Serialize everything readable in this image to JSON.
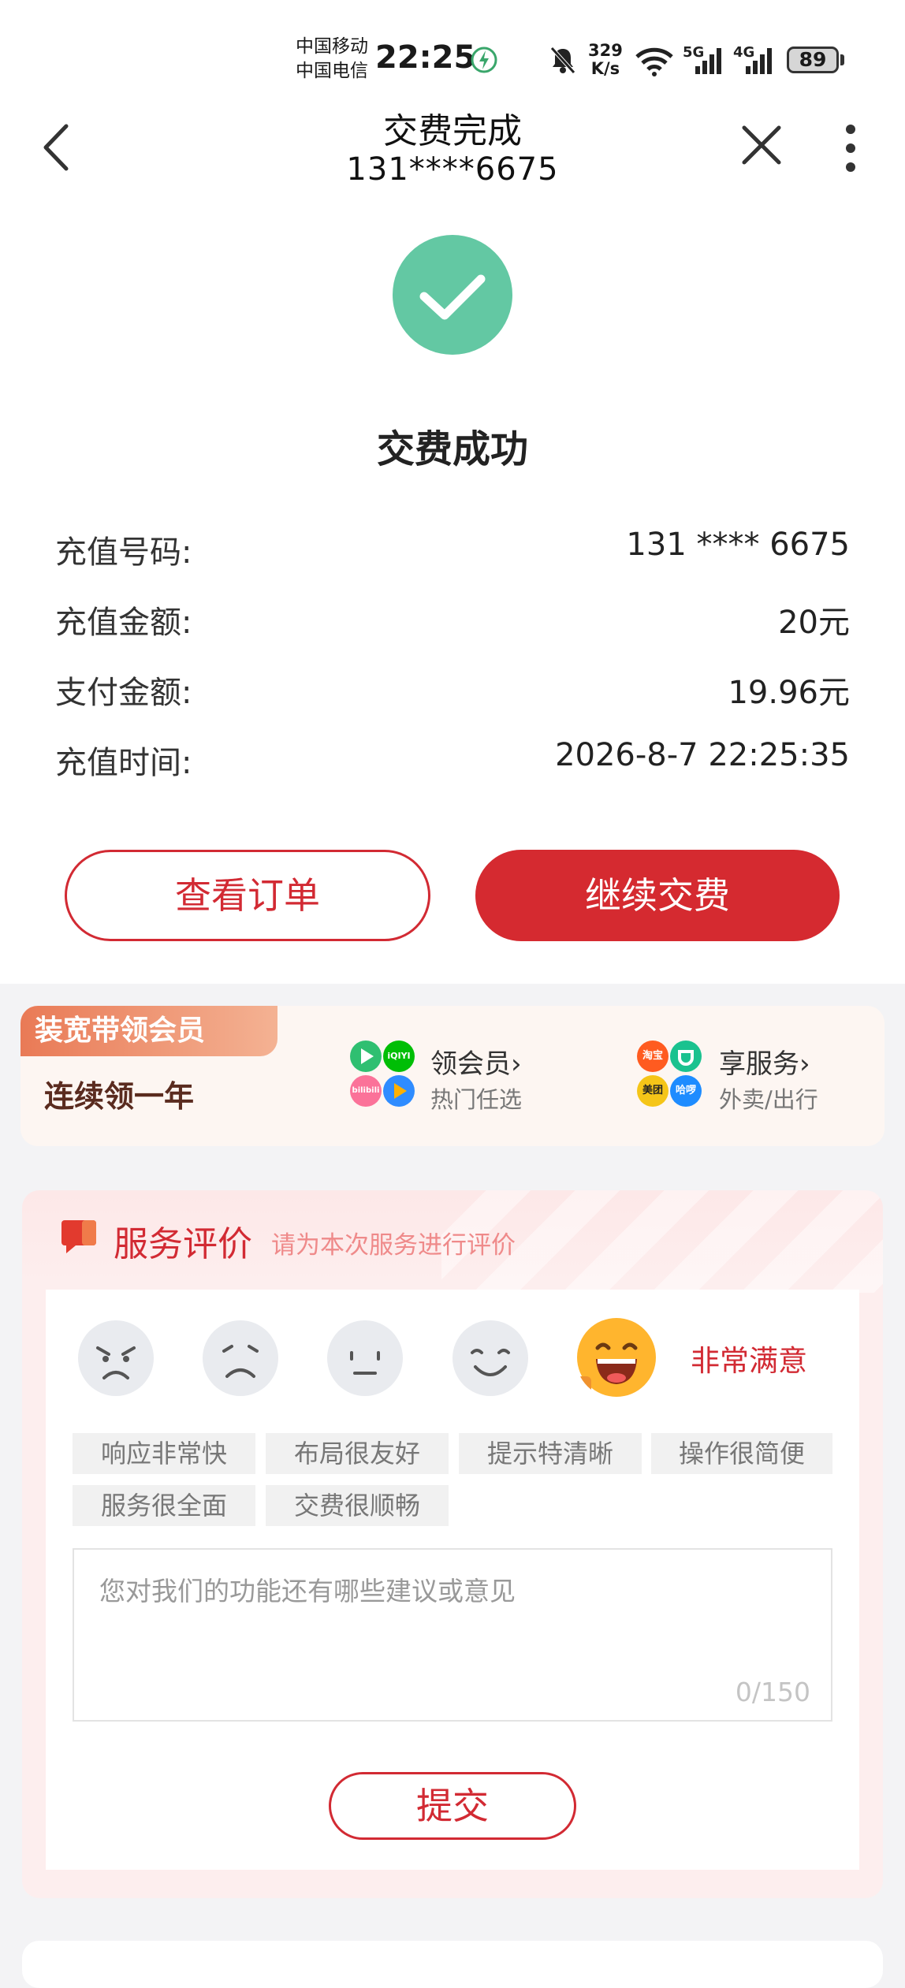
{
  "status_bar": {
    "carrier1": "中国移动",
    "carrier2": "中国电信",
    "time": "22:25",
    "speed_value": "329",
    "speed_unit": "K/s",
    "net1": "5G",
    "net2": "4G",
    "battery": "89"
  },
  "nav": {
    "title": "交费完成",
    "subtitle": "131****6675"
  },
  "result": {
    "title": "交费成功",
    "rows": [
      {
        "label": "充值号码:",
        "value": "131 **** 6675"
      },
      {
        "label": "充值金额:",
        "value": "20元"
      },
      {
        "label": "支付金额:",
        "value": "19.96元"
      },
      {
        "label": "充值时间:",
        "value": "2026-8-7 22:25:35"
      }
    ]
  },
  "actions": {
    "view_order": "查看订单",
    "continue_pay": "继续交费"
  },
  "promo": {
    "tag": "装宽带领会员",
    "main": "连续领一年",
    "item1_title": "领会员›",
    "item1_sub": "热门任选",
    "item2_title": "享服务›",
    "item2_sub": "外卖/出行",
    "logos": {
      "iqiyi": "iQIYI",
      "bili": "bilibili",
      "taobao": "淘宝",
      "meituan": "美团",
      "hello": "哈啰"
    }
  },
  "rating": {
    "title": "服务评价",
    "subtitle": "请为本次服务进行评价",
    "selected_label": "非常满意",
    "tags": [
      "响应非常快",
      "布局很友好",
      "提示特清晰",
      "操作很简便",
      "服务很全面",
      "交费很顺畅"
    ],
    "placeholder": "您对我们的功能还有哪些建议或意见",
    "counter": "0/150",
    "submit": "提交"
  },
  "colors": {
    "accent_red": "#d52a30",
    "success_green": "#63c8a3"
  },
  "icons": [
    "back-arrow-icon",
    "close-icon",
    "more-vertical-icon",
    "check-icon",
    "chat-icon",
    "angry-face-icon",
    "sad-face-icon",
    "neutral-face-icon",
    "smile-face-icon",
    "laugh-face-icon"
  ]
}
